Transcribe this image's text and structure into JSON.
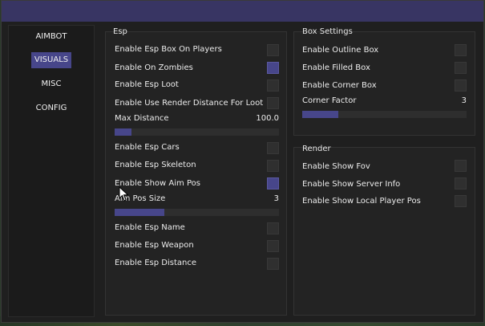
{
  "sidebar": {
    "items": [
      {
        "label": "AIMBOT",
        "active": false
      },
      {
        "label": "VISUALS",
        "active": true
      },
      {
        "label": "MISC",
        "active": false
      },
      {
        "label": "CONFIG",
        "active": false
      }
    ]
  },
  "esp": {
    "title": "Esp",
    "box_on_players": {
      "label": "Enable Esp Box On Players",
      "checked": false
    },
    "on_zombies": {
      "label": "Enable On Zombies",
      "checked": true
    },
    "esp_loot": {
      "label": "Enable Esp Loot",
      "checked": false
    },
    "render_distance_loot": {
      "label": "Enable Use Render Distance For Loot",
      "checked": false
    },
    "max_distance": {
      "label": "Max Distance",
      "value_text": "100.0",
      "fill": 0.1
    },
    "esp_cars": {
      "label": "Enable Esp Cars",
      "checked": false
    },
    "esp_skeleton": {
      "label": "Enable Esp Skeleton",
      "checked": false
    },
    "show_aim_pos": {
      "label": "Enable Show Aim Pos",
      "checked": true
    },
    "aim_pos_size": {
      "label": "Aim Pos Size",
      "value_text": "3",
      "fill": 0.3
    },
    "esp_name": {
      "label": "Enable Esp Name",
      "checked": false
    },
    "esp_weapon": {
      "label": "Enable Esp Weapon",
      "checked": false
    },
    "esp_distance": {
      "label": "Enable Esp Distance",
      "checked": false
    }
  },
  "box_settings": {
    "title": "Box Settings",
    "outline_box": {
      "label": "Enable Outline Box",
      "checked": false
    },
    "filled_box": {
      "label": "Enable Filled Box",
      "checked": false
    },
    "corner_box": {
      "label": "Enable Corner Box",
      "checked": false
    },
    "corner_factor": {
      "label": "Corner Factor",
      "value_text": "3",
      "fill": 0.22
    }
  },
  "render": {
    "title": "Render",
    "show_fov": {
      "label": "Enable Show Fov",
      "checked": false
    },
    "server_info": {
      "label": "Enable Show Server Info",
      "checked": false
    },
    "local_player_pos": {
      "label": "Enable Show Local Player Pos",
      "checked": false
    }
  },
  "colors": {
    "accent": "#47468a",
    "titlebar": "#383563",
    "window_bg": "#1f1f1f",
    "panel_bg": "#232323"
  }
}
